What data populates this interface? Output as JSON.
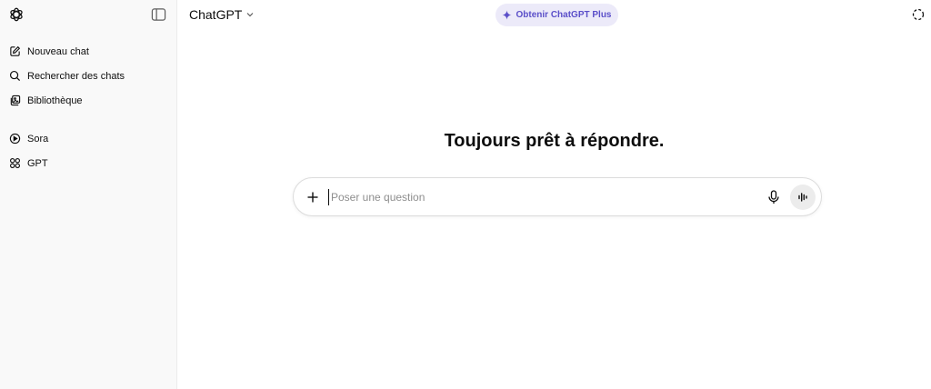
{
  "sidebar": {
    "items": [
      {
        "label": "Nouveau chat",
        "icon": "edit-icon"
      },
      {
        "label": "Rechercher des chats",
        "icon": "search-icon"
      },
      {
        "label": "Bibliothèque",
        "icon": "library-icon"
      }
    ],
    "apps": [
      {
        "label": "Sora",
        "icon": "play-circle-icon"
      },
      {
        "label": "GPT",
        "icon": "grid-icon"
      }
    ]
  },
  "header": {
    "model": "ChatGPT",
    "upgrade_label": "Obtenir ChatGPT Plus"
  },
  "main": {
    "headline": "Toujours prêt à répondre.",
    "composer_placeholder": "Poser une question"
  },
  "colors": {
    "accent": "#5b4fc9",
    "pill_bg": "#eceaf9",
    "sidebar_bg": "#f9f9f9"
  }
}
